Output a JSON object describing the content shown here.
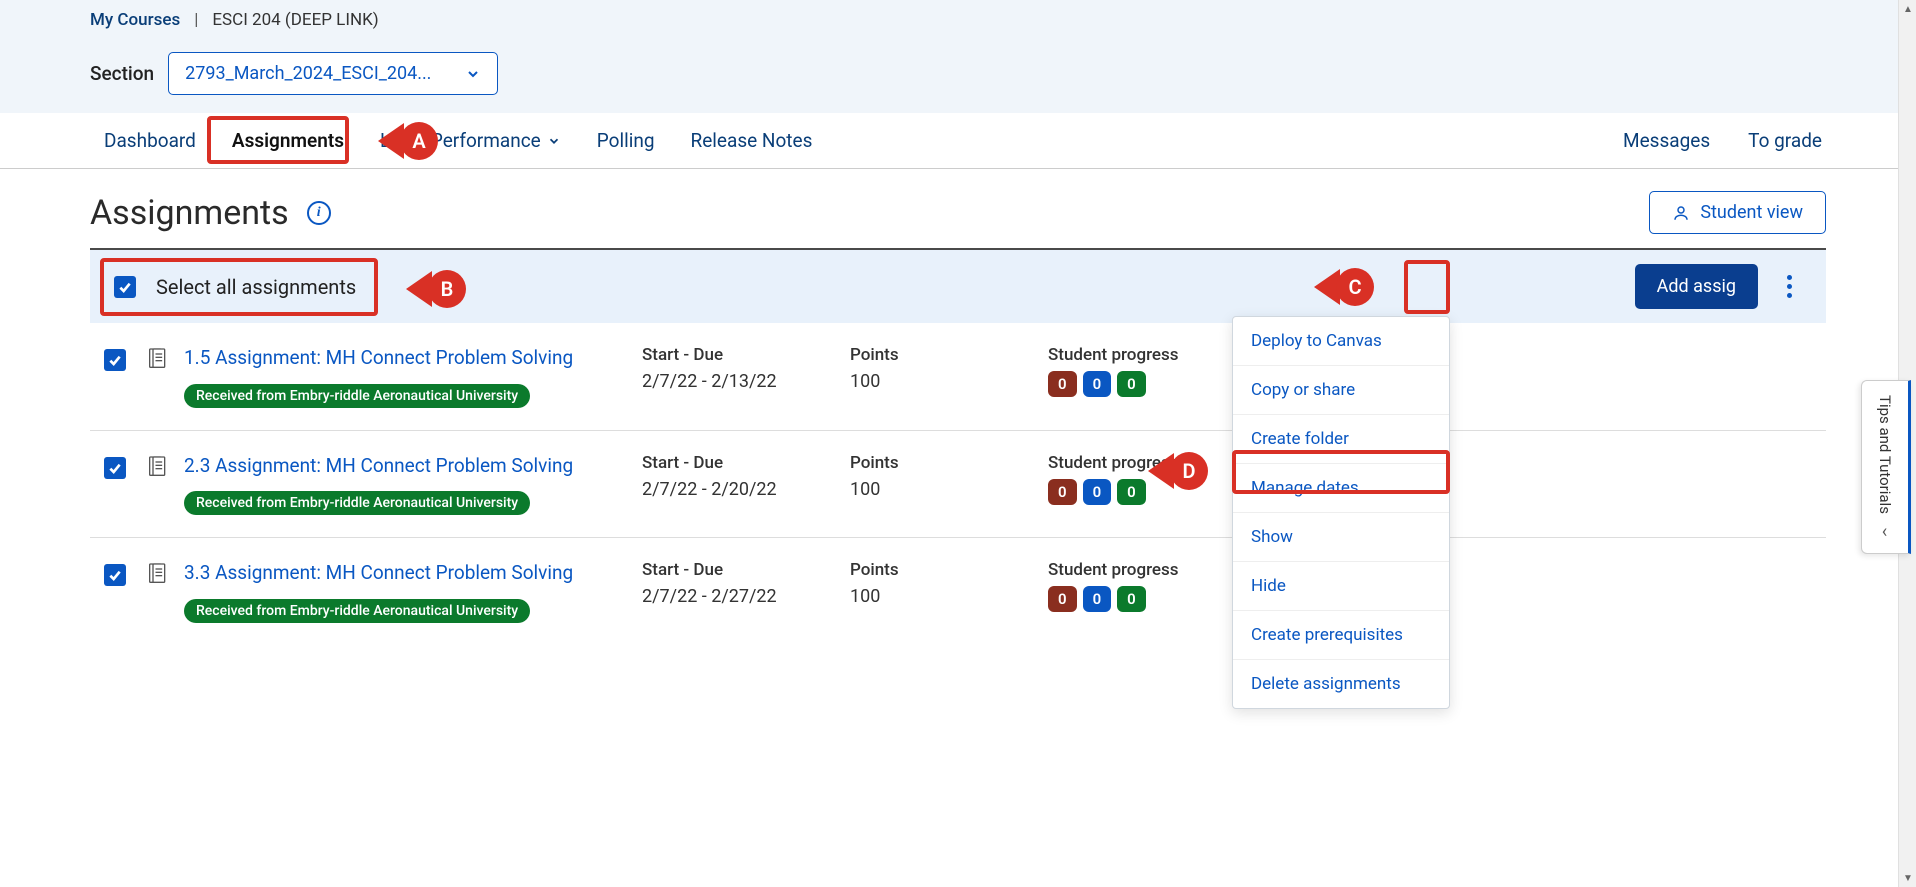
{
  "breadcrumb": {
    "my_courses": "My Courses",
    "current": "ESCI 204 (DEEP LINK)"
  },
  "section": {
    "label": "Section",
    "selected": "2793_March_2024_ESCI_204..."
  },
  "nav": {
    "dashboard": "Dashboard",
    "assignments": "Assignments",
    "library": "Li",
    "performance": "Performance",
    "polling": "Polling",
    "release_notes": "Release Notes",
    "messages": "Messages",
    "to_grade": "To grade"
  },
  "page": {
    "title": "Assignments",
    "student_view": "Student view"
  },
  "toolbar": {
    "select_all": "Select all assignments",
    "add": "Add assig"
  },
  "dropdown": {
    "deploy": "Deploy to Canvas",
    "copy": "Copy or share",
    "create_folder": "Create folder",
    "manage_dates": "Manage dates",
    "show": "Show",
    "hide": "Hide",
    "create_prereq": "Create prerequisites",
    "delete": "Delete assignments"
  },
  "columns": {
    "dates": "Start - Due",
    "points": "Points",
    "progress": "Student progress",
    "d": "D"
  },
  "rows": [
    {
      "title": "1.5 Assignment: MH Connect Problem Solving",
      "badge": "Received from Embry-riddle Aeronautical University",
      "dates": "2/7/22 - 2/13/22",
      "points": "100",
      "p1": "0",
      "p2": "0",
      "p3": "0"
    },
    {
      "title": "2.3 Assignment: MH Connect Problem Solving",
      "badge": "Received from Embry-riddle Aeronautical University",
      "dates": "2/7/22 - 2/20/22",
      "points": "100",
      "p1": "0",
      "p2": "0",
      "p3": "0"
    },
    {
      "title": "3.3 Assignment: MH Connect Problem Solving",
      "badge": "Received from Embry-riddle Aeronautical University",
      "dates": "2/7/22 - 2/27/22",
      "points": "100",
      "p1": "0",
      "p2": "0",
      "p3": "0"
    }
  ],
  "callouts": {
    "a": "A",
    "b": "B",
    "c": "C",
    "d": "D"
  },
  "side_tab": "Tips and Tutorials"
}
